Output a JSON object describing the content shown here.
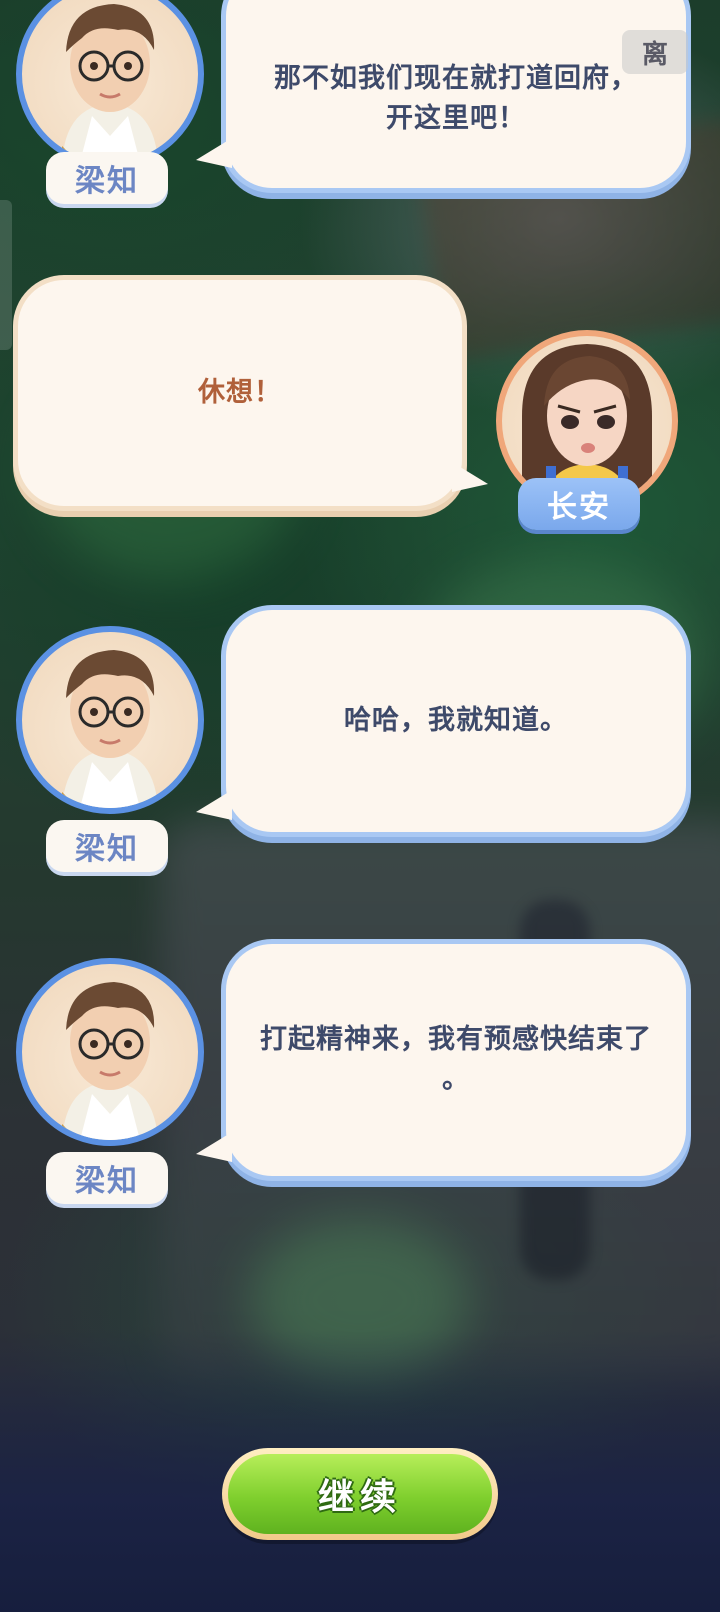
{
  "dialogue": [
    {
      "speaker": "梁知",
      "text": "那不如我们现在就打道回府，离开这里吧！",
      "line1": "那不如我们现在就打道回府，",
      "line2": "开这里吧！"
    },
    {
      "speaker": "长安",
      "text": "休想！"
    },
    {
      "speaker": "梁知",
      "text": "哈哈，我就知道。"
    },
    {
      "speaker": "梁知",
      "line1": "打起精神来，我有预感快结束了",
      "line2": "。"
    }
  ],
  "skip_label": "离",
  "continue_label": "继续",
  "icons": {
    "male_avatar": "man-with-glasses-avatar-icon",
    "female_avatar": "girl-with-long-hair-avatar-icon"
  },
  "colors": {
    "bubble_fill": "#fdf6ee",
    "blue_outline": "#a9c8f3",
    "warm_outline": "#f3dfc6",
    "male_text": "#3e4a6a",
    "female_text": "#b0603a",
    "continue_green": "#7fcf2e"
  }
}
